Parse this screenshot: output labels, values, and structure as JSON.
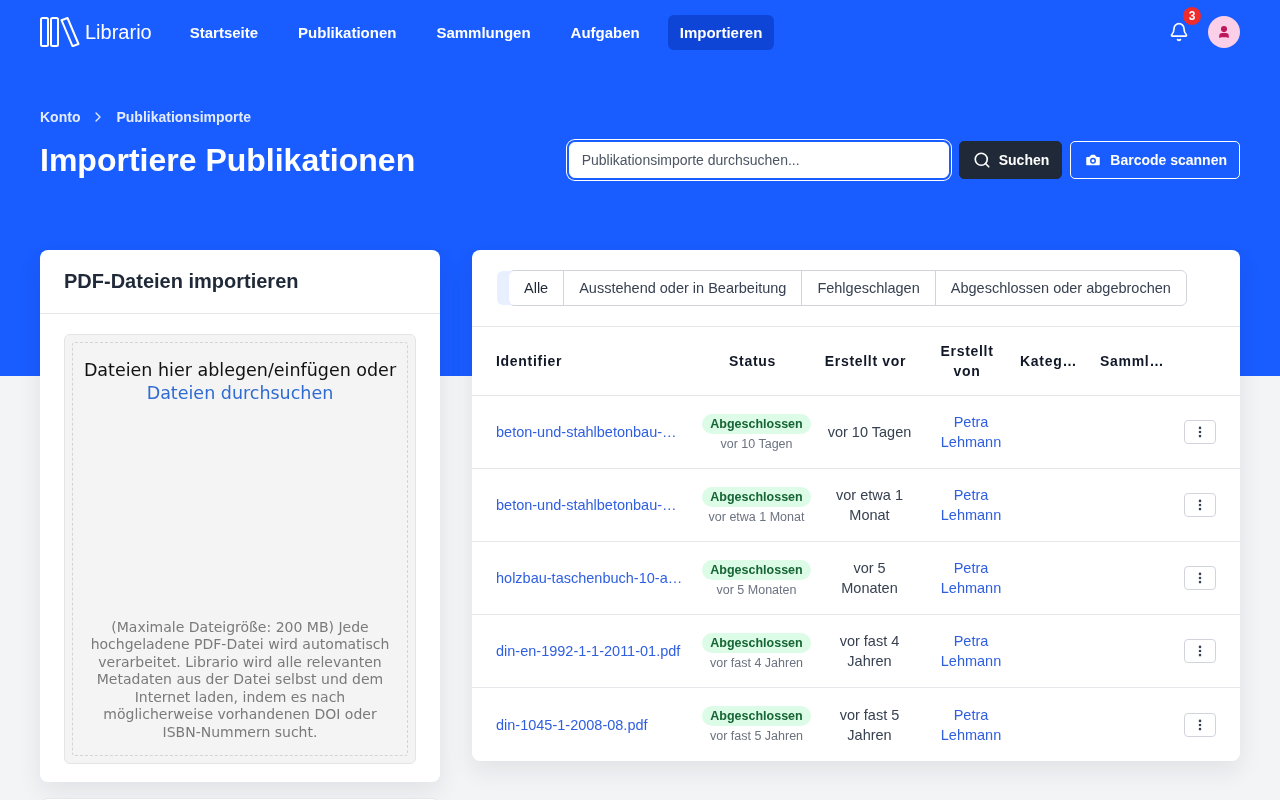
{
  "header": {
    "logo_text": "Librario",
    "nav": [
      {
        "label": "Startseite",
        "selected": false
      },
      {
        "label": "Publikationen",
        "selected": false
      },
      {
        "label": "Sammlungen",
        "selected": false
      },
      {
        "label": "Aufgaben",
        "selected": false
      },
      {
        "label": "Importieren",
        "selected": true
      }
    ],
    "notification_count": "3"
  },
  "page_header": {
    "breadcrumb": [
      "Konto",
      "Publikationsimporte"
    ],
    "title": "Importiere Publikationen",
    "search": {
      "placeholder": "Publikationsimporte durchsuchen..."
    },
    "buttons": [
      {
        "kind": "search",
        "label": "Suchen"
      },
      {
        "kind": "barcode",
        "label": "Barcode scannen"
      }
    ]
  },
  "upload_card": {
    "title": "PDF-Dateien importieren",
    "dropzone": {
      "prompt": "Dateien hier ablegen/einfügen oder",
      "browse_link": "Dateien durchsuchen",
      "note": "(Maximale Dateigröße: 200 MB) Jede hochgeladene PDF-Datei wird automatisch verarbeitet. Librario wird alle relevanten Metadaten aus der Datei selbst und dem Internet laden, indem es nach möglicherweise vorhandenen DOI oder ISBN-Nummern sucht."
    }
  },
  "imports": {
    "filters": [
      {
        "label": "Alle",
        "selected": true
      },
      {
        "label": "Ausstehend oder in Bearbeitung",
        "selected": false
      },
      {
        "label": "Fehlgeschlagen",
        "selected": false
      },
      {
        "label": "Abgeschlossen oder abgebrochen",
        "selected": false
      }
    ],
    "columns": [
      "Identifier",
      "Status",
      "Erstellt vor",
      "Erstellt von",
      "Kateg…",
      "Samml…"
    ],
    "rows": [
      {
        "identifier": "beton-und-stahlbetonbau-…",
        "status": {
          "label": "Abgeschlossen",
          "time": "vor 10 Tagen"
        },
        "created_ago": "vor 10 Tagen",
        "created_by": "Petra Lehmann"
      },
      {
        "identifier": "beton-und-stahlbetonbau-…",
        "status": {
          "label": "Abgeschlossen",
          "time": "vor etwa 1 Monat"
        },
        "created_ago": "vor etwa 1 Monat",
        "created_by": "Petra Lehmann"
      },
      {
        "identifier": "holzbau-taschenbuch-10-a…",
        "status": {
          "label": "Abgeschlossen",
          "time": "vor 5 Monaten"
        },
        "created_ago": "vor 5 Monaten",
        "created_by": "Petra Lehmann"
      },
      {
        "identifier": "din-en-1992-1-1-2011-01.pdf",
        "status": {
          "label": "Abgeschlossen",
          "time": "vor fast 4 Jahren"
        },
        "created_ago": "vor fast 4 Jahren",
        "created_by": "Petra Lehmann"
      },
      {
        "identifier": "din-1045-1-2008-08.pdf",
        "status": {
          "label": "Abgeschlossen",
          "time": "vor fast 5 Jahren"
        },
        "created_ago": "vor fast 5 Jahren",
        "created_by": "Petra Lehmann"
      }
    ]
  }
}
